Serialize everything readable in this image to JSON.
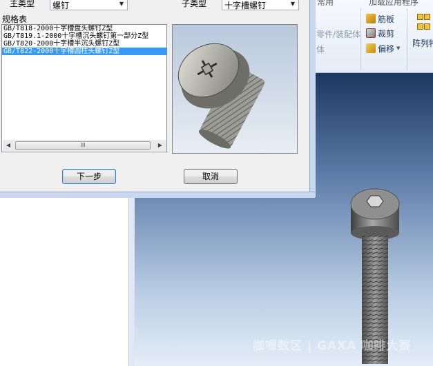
{
  "dialog": {
    "main_type_label": "主类型",
    "main_type_value": "螺钉",
    "sub_type_label": "子类型",
    "sub_type_value": "十字槽螺钉",
    "spec_table_label": "规格表",
    "spec_items": [
      "GB/T818-2000十字槽盘头螺钉Z型",
      "GB/T819.1-2000十字槽沉头螺钉第一部分Z型",
      "GB/T820-2000十字槽半沉头螺钉Z型",
      "GB/T822-2000十字槽圆柱头螺钉Z型"
    ],
    "selected_index": 3,
    "scroll_thumb_text": "III",
    "next_button": "下一步",
    "cancel_button": "取消"
  },
  "ribbon": {
    "tabs": [
      "常用",
      "加载应用程序"
    ],
    "part_assembly": "零件/装配体",
    "body": "体",
    "rib": "筋板",
    "trim": "裁剪",
    "offset": "偏移",
    "array": "阵列特"
  },
  "watermark": "咖喱数区 | GAXA 咖啡大赛",
  "colors": {
    "selection": "#3399ff",
    "dialog_bg": "#f0f0f0",
    "viewport_top": "#1b3760",
    "viewport_bottom": "#e5eef8"
  }
}
